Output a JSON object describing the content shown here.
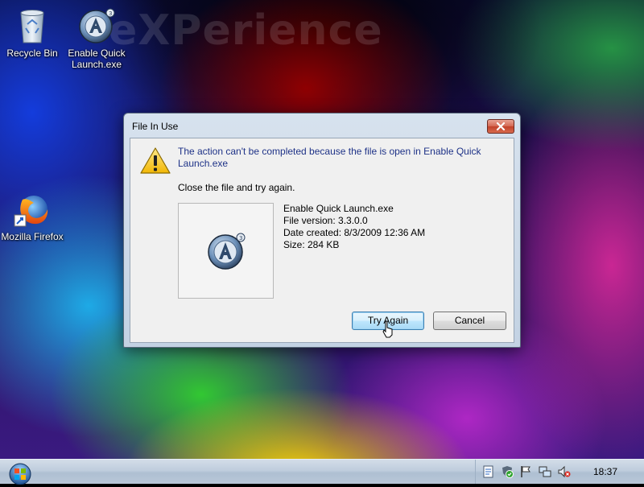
{
  "desktop": {
    "watermark": "eXPerience",
    "icons": [
      {
        "label": "Recycle Bin",
        "icon": "recycle-bin-icon"
      },
      {
        "label": "Enable Quick\nLaunch.exe",
        "icon": "app-logo-icon"
      },
      {
        "label": "Mozilla Firefox",
        "icon": "firefox-icon"
      }
    ]
  },
  "dialog": {
    "title": "File In Use",
    "message": "The action can't be completed because the file is open in Enable Quick Launch.exe",
    "instruction": "Close the file and try again.",
    "file": {
      "name": "Enable Quick Launch.exe",
      "version": "File version: 3.3.0.0",
      "date_created": "Date created: 8/3/2009 12:36 AM",
      "size": "Size: 284 KB"
    },
    "buttons": {
      "try_again": "Try Again",
      "cancel": "Cancel"
    }
  },
  "taskbar": {
    "clock": "18:37",
    "tray_icons": [
      "notes-icon",
      "security-shield-icon",
      "action-center-flag-icon",
      "network-icon",
      "volume-muted-icon"
    ]
  },
  "colors": {
    "message_text": "#1e3287",
    "default_button_border": "#3c7fb1",
    "close_button": "#c2412a"
  }
}
